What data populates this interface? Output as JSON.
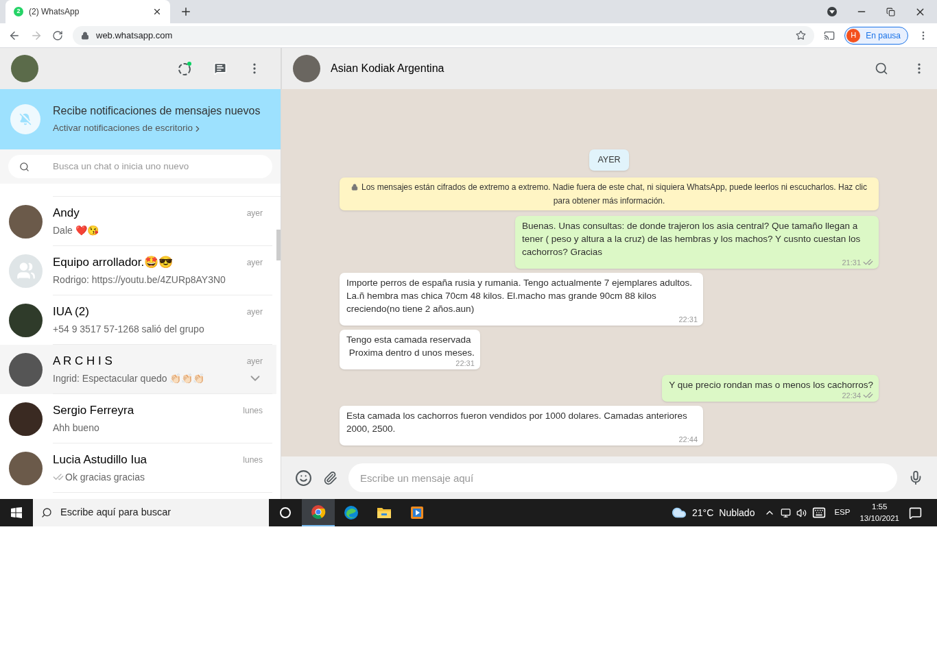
{
  "browser": {
    "tab": {
      "badge": "2",
      "title": "(2) WhatsApp"
    },
    "url": "web.whatsapp.com",
    "profile": {
      "initial": "H",
      "label": "En pausa"
    }
  },
  "notification_banner": {
    "title": "Recibe notificaciones de mensajes nuevos",
    "link": "Activar notificaciones de escritorio"
  },
  "search": {
    "placeholder": "Busca un chat o inicia uno nuevo"
  },
  "chats": [
    {
      "name": "Andy",
      "preview": "Dale ❤️😘",
      "time": "ayer",
      "kind": "photo",
      "selected": false,
      "read_ticks": false
    },
    {
      "name": "Equipo arrollador.🤩😎",
      "preview": "Rodrigo: https://youtu.be/4ZURp8AY3N0",
      "time": "ayer",
      "kind": "group",
      "selected": false,
      "read_ticks": false
    },
    {
      "name": "IUA (2)",
      "preview": "+54 9 3517 57-1268 salió del grupo",
      "time": "ayer",
      "kind": "photo",
      "selected": false,
      "read_ticks": false
    },
    {
      "name": "A R C H I S",
      "preview": "Ingrid: Espectacular quedo 👏🏻👏🏻👏🏻",
      "time": "ayer",
      "kind": "photo",
      "selected": true,
      "read_ticks": false
    },
    {
      "name": "Sergio Ferreyra",
      "preview": "Ahh bueno",
      "time": "lunes",
      "kind": "photo",
      "selected": false,
      "read_ticks": false
    },
    {
      "name": "Lucia Astudillo Iua",
      "preview": "Ok gracias gracias",
      "time": "lunes",
      "kind": "photo",
      "selected": false,
      "read_ticks": true
    }
  ],
  "conversation": {
    "name": "Asian Kodiak Argentina",
    "messages": [
      {
        "kind": "date",
        "text": "AYER"
      },
      {
        "kind": "notice",
        "text": "Los mensajes están cifrados de extremo a extremo. Nadie fuera de este chat, ni siquiera WhatsApp, puede leerlos ni escucharlos. Haz clic para obtener más información."
      },
      {
        "kind": "outgoing",
        "text": "Buenas. Unas consultas: de donde trajeron los asia central? Que tamaño llegan a tener ( peso y altura a la cruz) de las hembras y los machos? Y cusnto cuestan los cachorros? Gracias",
        "time": "21:31"
      },
      {
        "kind": "incoming",
        "text": "Importe perros de españa rusia y rumania. Tengo actualmente 7 ejemplares adultos. La.ñ hembra mas chica 70cm 48 kilos. El.macho mas grande 90cm 88 kilos creciendo(no tiene 2 años.aun)",
        "time": "22:31"
      },
      {
        "kind": "incoming",
        "text": "Tengo esta camada reservada\n Proxima dentro d unos meses.",
        "time": "22:31"
      },
      {
        "kind": "outgoing",
        "text": "Y que precio rondan mas o menos los cachorros?",
        "time": "22:34"
      },
      {
        "kind": "incoming",
        "text": "Esta camada los cachorros fueron vendidos por 1000 dolares. Camadas anteriores 2000, 2500.",
        "time": "22:44"
      }
    ]
  },
  "composer": {
    "placeholder": "Escribe un mensaje aquí"
  },
  "taskbar": {
    "search_placeholder": "Escribe aquí para buscar",
    "apps": [
      {
        "kind": "cortana",
        "selected": false
      },
      {
        "kind": "chrome",
        "selected": true
      },
      {
        "kind": "edge",
        "selected": false
      },
      {
        "kind": "files",
        "selected": false
      },
      {
        "kind": "media",
        "selected": false
      }
    ],
    "temperature": "21°C",
    "weather": "Nublado",
    "language": "ESP",
    "time": "1:55",
    "date": "13/10/2021"
  }
}
